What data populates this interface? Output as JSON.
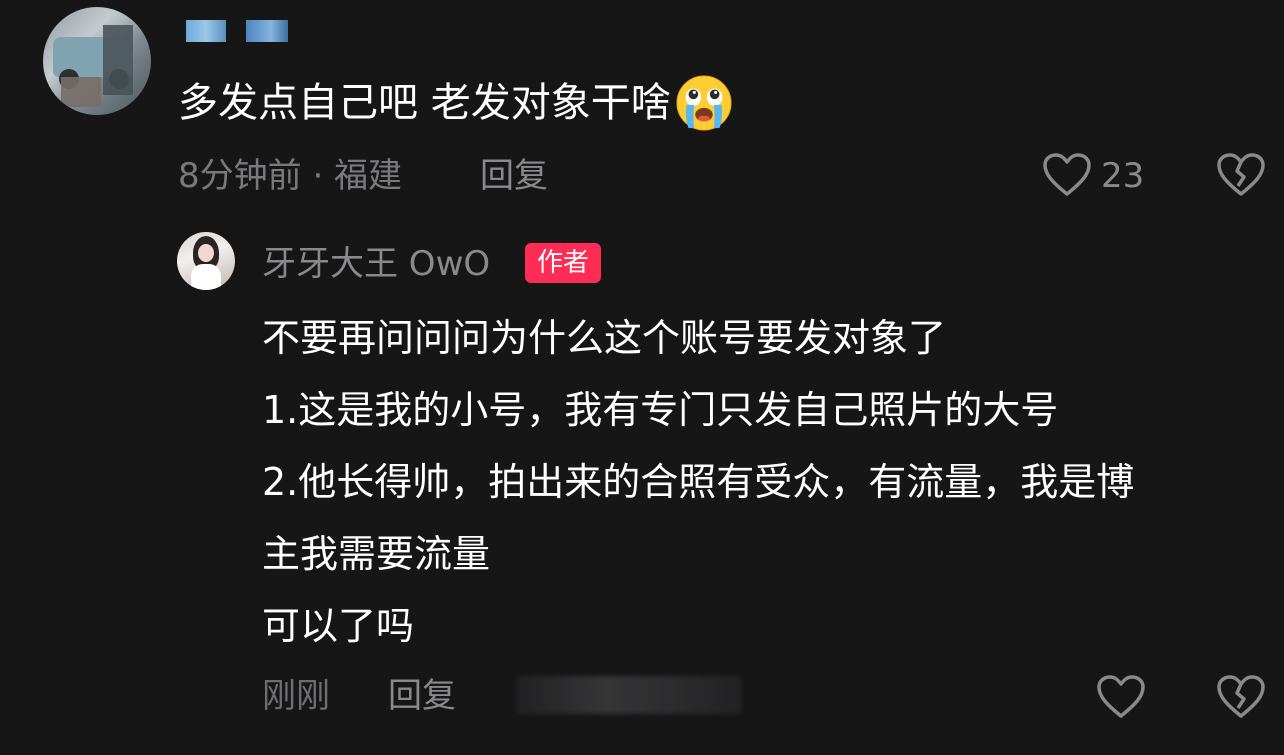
{
  "comment": {
    "text": "多发点自己吧 老发对象干啥",
    "emoji": "loudly-crying-face",
    "time_location": "8分钟前 · 福建",
    "reply_label": "回复",
    "like_count": "23"
  },
  "reply": {
    "author_name": "牙牙大王 OwO",
    "author_badge": "作者",
    "lines": [
      "不要再问问问为什么这个账号要发对象了",
      "1.这是我的小号，我有专门只发自己照片的大号",
      "2.他长得帅，拍出来的合照有受众，有流量，我是博",
      "主我需要流量",
      "可以了吗"
    ],
    "time": "刚刚",
    "reply_label": "回复"
  },
  "colors": {
    "background": "#161617",
    "badge": "#fe2c55",
    "muted_text": "#8a8a8d"
  }
}
